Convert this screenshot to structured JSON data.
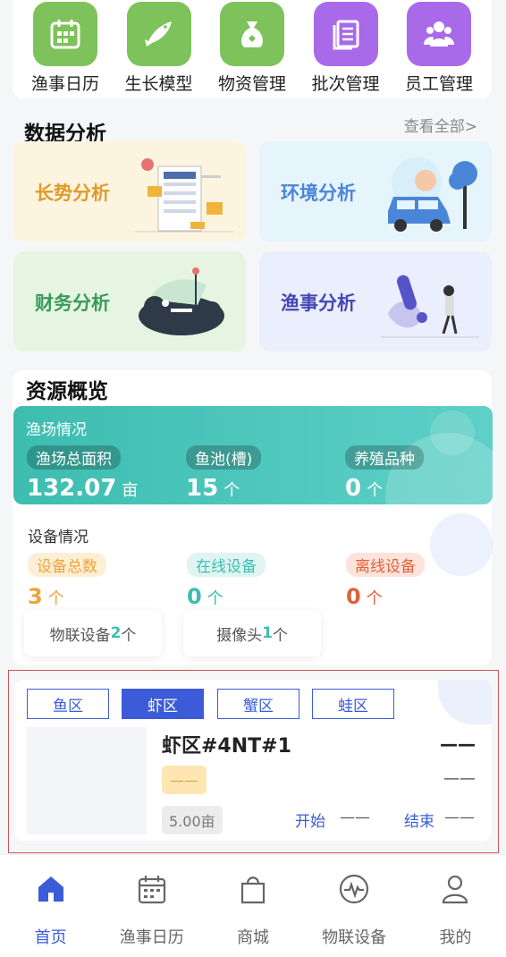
{
  "quick_nav": [
    {
      "label": "渔事日历",
      "icon": "calendar-icon",
      "color": "#7dc25a"
    },
    {
      "label": "生长模型",
      "icon": "fish-icon",
      "color": "#7dc25a"
    },
    {
      "label": "物资管理",
      "icon": "money-bag-icon",
      "color": "#7dc25a"
    },
    {
      "label": "批次管理",
      "icon": "document-list-icon",
      "color": "#a86ae8"
    },
    {
      "label": "员工管理",
      "icon": "people-icon",
      "color": "#a86ae8"
    }
  ],
  "analysis": {
    "title": "数据分析",
    "see_all": "查看全部>",
    "cards": [
      {
        "label": "长势分析",
        "color": "#e09a2a",
        "bg": "#fdf4df"
      },
      {
        "label": "环境分析",
        "color": "#4a86d8",
        "bg": "#e6f4fc"
      },
      {
        "label": "财务分析",
        "color": "#3a9a5a",
        "bg": "#e6f5e2"
      },
      {
        "label": "渔事分析",
        "color": "#4646b4",
        "bg": "#ebeefc"
      }
    ]
  },
  "resources": {
    "title": "资源概览",
    "fishery": {
      "title": "渔场情况",
      "items": [
        {
          "label": "渔场总面积",
          "value": "132.07",
          "unit": "亩"
        },
        {
          "label": "鱼池(槽)",
          "value": "15",
          "unit": "个"
        },
        {
          "label": "养殖品种",
          "value": "0",
          "unit": "个"
        }
      ]
    },
    "devices": {
      "title": "设备情况",
      "items": [
        {
          "label": "设备总数",
          "value": "3",
          "unit": "个",
          "color": "#f0a33a",
          "bg": "#fdefd6"
        },
        {
          "label": "在线设备",
          "value": "0",
          "unit": "个",
          "color": "#3dbdb0",
          "bg": "#dff5f2"
        },
        {
          "label": "离线设备",
          "value": "0",
          "unit": "个",
          "color": "#e0623a",
          "bg": "#fde3da"
        }
      ],
      "iot_prefix": "物联设备",
      "iot_count": "2",
      "iot_suffix": "个",
      "cam_prefix": "摄像头",
      "cam_count": "1",
      "cam_suffix": "个"
    }
  },
  "zones": {
    "tabs": [
      "鱼区",
      "虾区",
      "蟹区",
      "蛙区"
    ],
    "active_tab": 1,
    "item": {
      "name": "虾区#4NT#1",
      "top_right": "——",
      "tag": "——",
      "mid_right": "——",
      "area": "5.00亩",
      "start_label": "开始",
      "start_value": "——",
      "end_label": "结束",
      "end_value": "——"
    }
  },
  "tabbar": [
    {
      "label": "首页",
      "icon": "home-icon",
      "active": true
    },
    {
      "label": "渔事日历",
      "icon": "calendar-icon",
      "active": false
    },
    {
      "label": "商城",
      "icon": "shopping-bag-icon",
      "active": false
    },
    {
      "label": "物联设备",
      "icon": "pulse-icon",
      "active": false
    },
    {
      "label": "我的",
      "icon": "user-icon",
      "active": false
    }
  ],
  "colors": {
    "accent": "#3b5bd8",
    "teal": "#3dbdb0"
  }
}
